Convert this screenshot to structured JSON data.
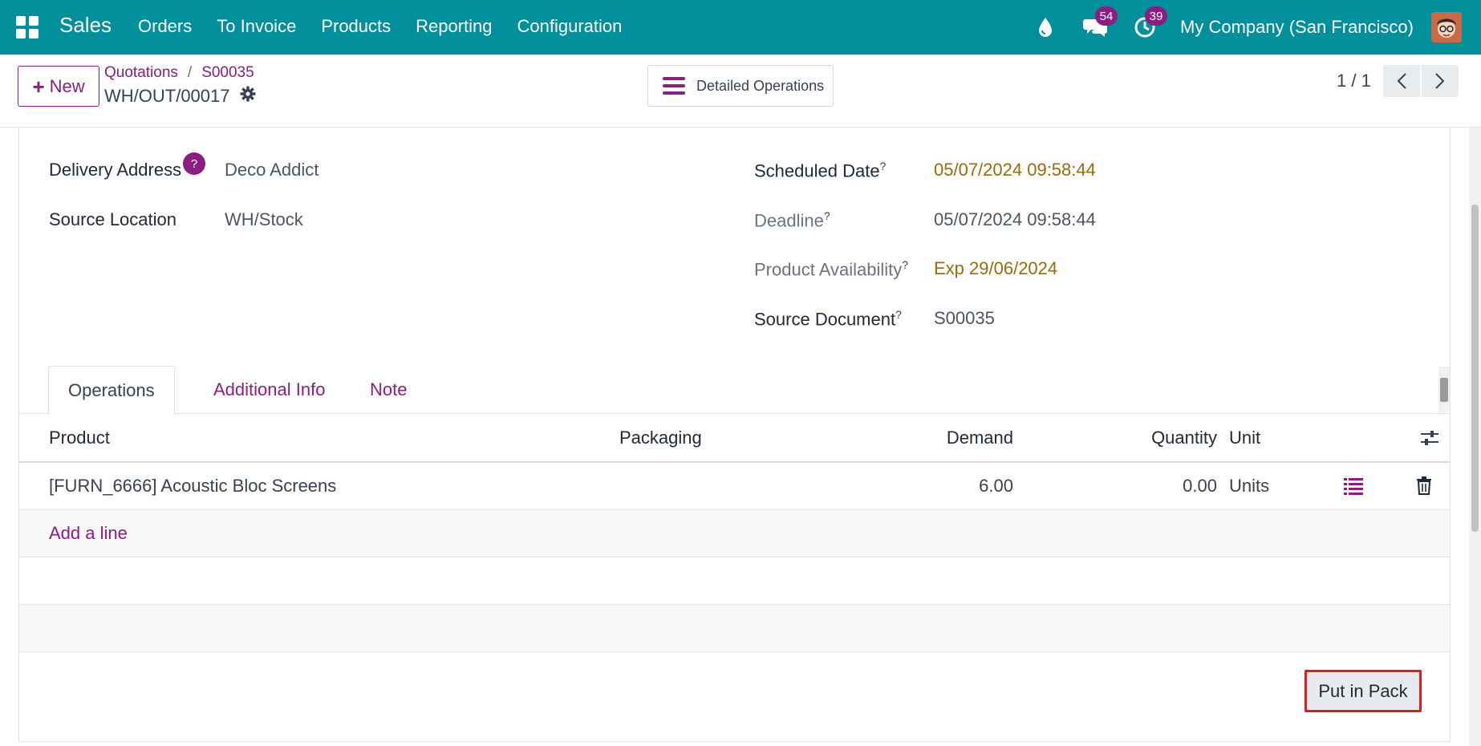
{
  "navbar": {
    "brand": "Sales",
    "menu": [
      "Orders",
      "To Invoice",
      "Products",
      "Reporting",
      "Configuration"
    ],
    "messages_count": "54",
    "activities_count": "39",
    "company": "My Company (San Francisco)",
    "icons": [
      "apps-icon",
      "droplet-icon",
      "chat-icon",
      "clock-icon",
      "avatar"
    ]
  },
  "control": {
    "new_label": "New",
    "breadcrumb": [
      "Quotations",
      "S00035"
    ],
    "record_name": "WH/OUT/00017",
    "detailed_label": "Detailed Operations",
    "pager": "1 / 1"
  },
  "form": {
    "delivery_address_label": "Delivery Address",
    "delivery_address_help": "?",
    "delivery_address": "Deco Addict",
    "source_location_label": "Source Location",
    "source_location": "WH/Stock",
    "scheduled_date_label": "Scheduled Date",
    "scheduled_date": "05/07/2024 09:58:44",
    "deadline_label": "Deadline",
    "deadline": "05/07/2024 09:58:44",
    "availability_label": "Product Availability",
    "availability": "Exp 29/06/2024",
    "source_document_label": "Source Document",
    "source_document": "S00035",
    "help_mark": "?"
  },
  "tabs": [
    "Operations",
    "Additional Info",
    "Note"
  ],
  "table": {
    "headers": {
      "product": "Product",
      "packaging": "Packaging",
      "demand": "Demand",
      "quantity": "Quantity",
      "unit": "Unit"
    },
    "rows": [
      {
        "product": "[FURN_6666] Acoustic Bloc Screens",
        "packaging": "",
        "demand": "6.00",
        "quantity": "0.00",
        "unit": "Units"
      }
    ],
    "add_line": "Add a line"
  },
  "actions": {
    "put_in_pack": "Put in Pack"
  },
  "colors": {
    "navbar": "#018f9b",
    "accent": "#8b1d83",
    "warning_text": "#9a6b0b",
    "highlight_border": "#e01b1b"
  }
}
